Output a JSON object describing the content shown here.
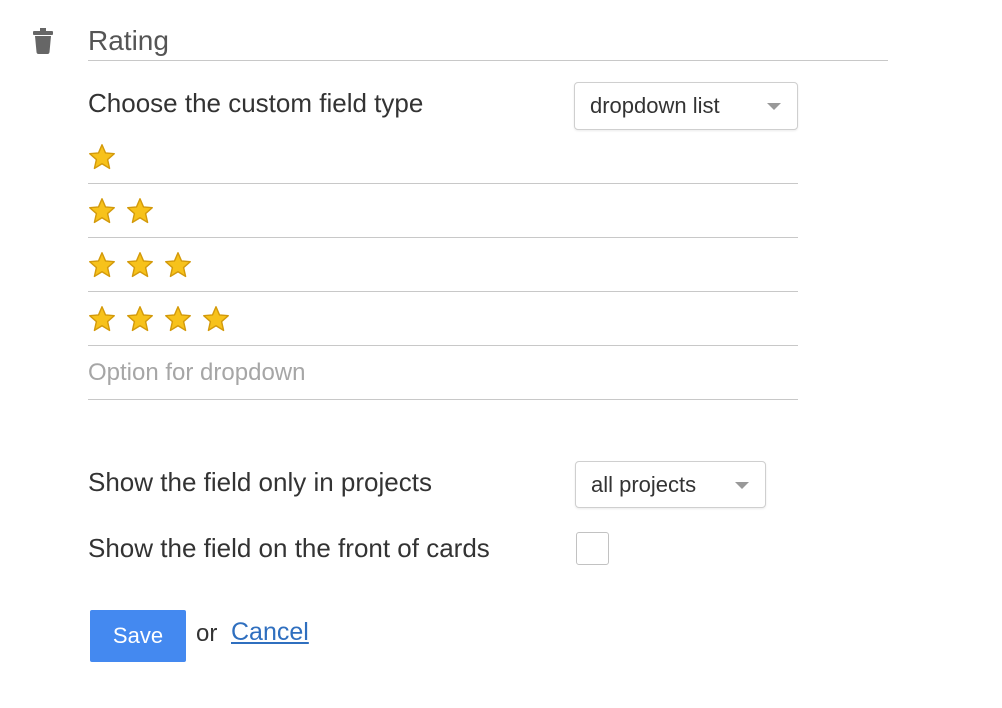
{
  "field": {
    "name_value": "Rating"
  },
  "type_section": {
    "label": "Choose the custom field type",
    "selected": "dropdown list"
  },
  "options": {
    "items": [
      {
        "stars": 1
      },
      {
        "stars": 2
      },
      {
        "stars": 3
      },
      {
        "stars": 4
      }
    ],
    "new_option_placeholder": "Option for dropdown"
  },
  "projects_section": {
    "label": "Show the field only in projects",
    "selected": "all projects"
  },
  "front_section": {
    "label": "Show the field on the front of cards",
    "checked": false
  },
  "actions": {
    "save_label": "Save",
    "or_text": "or",
    "cancel_label": "Cancel"
  },
  "colors": {
    "accent": "#4489f0",
    "link": "#2f6fbf",
    "star_fill": "#f7c21b",
    "star_stroke": "#d39a0b"
  },
  "icons": {
    "delete": "trash-icon",
    "rating": "star-icon",
    "dropdown": "caret-down-icon"
  }
}
